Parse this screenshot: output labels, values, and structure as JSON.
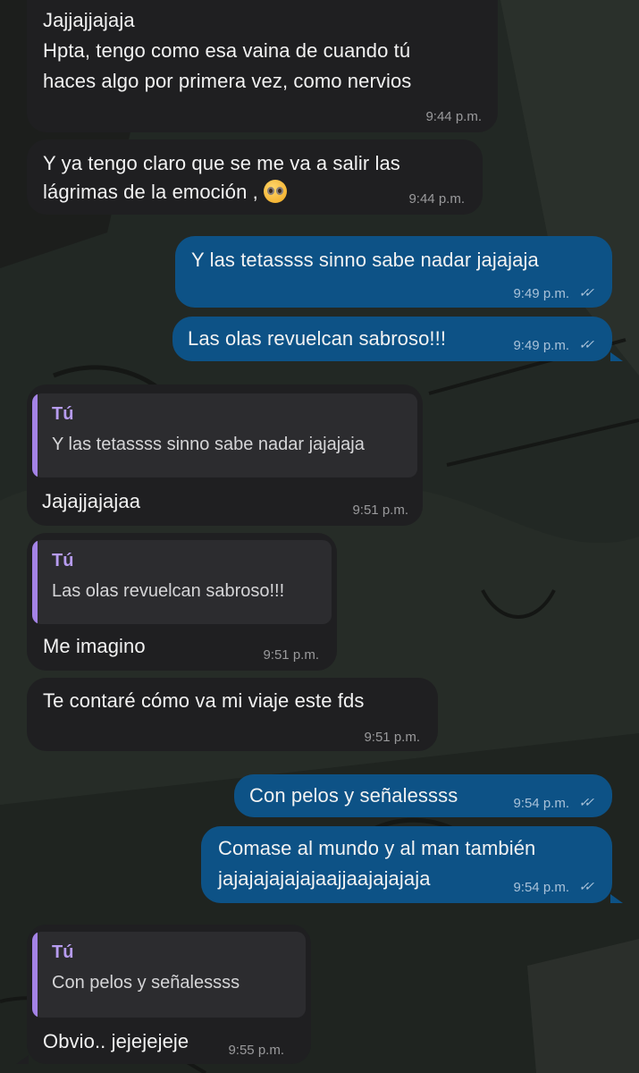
{
  "messages": [
    {
      "lines": [
        "Jajjajjajaja",
        "Hpta, tengo como esa vaina de cuando tú",
        "haces algo por primera vez, como nervios"
      ],
      "time": "9:44 p.m."
    },
    {
      "lines": [
        "Y ya tengo claro que se me va a salir las",
        "lágrimas de la emoción ,"
      ],
      "emoji": "pleading-face-emoji",
      "time": "9:44 p.m."
    },
    {
      "text": "Y las tetassss sinno sabe nadar jajajaja",
      "time": "9:49 p.m."
    },
    {
      "text": "Las olas revuelcan sabroso!!!",
      "time": "9:49 p.m."
    },
    {
      "quote_author": "Tú",
      "quote_text": "Y las tetassss sinno sabe nadar jajajaja",
      "text": "Jajajjajajaa",
      "time": "9:51 p.m."
    },
    {
      "quote_author": "Tú",
      "quote_text": "Las olas revuelcan sabroso!!!",
      "text": "Me imagino",
      "time": "9:51 p.m."
    },
    {
      "text": "Te contaré cómo va mi viaje este fds",
      "time": "9:51 p.m."
    },
    {
      "text": "Con pelos y señalessss",
      "time": "9:54 p.m."
    },
    {
      "lines": [
        "Comase al mundo y al man también",
        "jajajajajajajaajjaajajajaja"
      ],
      "time": "9:54 p.m."
    },
    {
      "quote_author": "Tú",
      "quote_text": "Con pelos y señalessss",
      "text": "Obvio.. jejejejeje",
      "time": "9:55 p.m."
    }
  ],
  "read_ticks": "✓✓",
  "icons": {
    "read_receipt": "double-check-icon"
  }
}
